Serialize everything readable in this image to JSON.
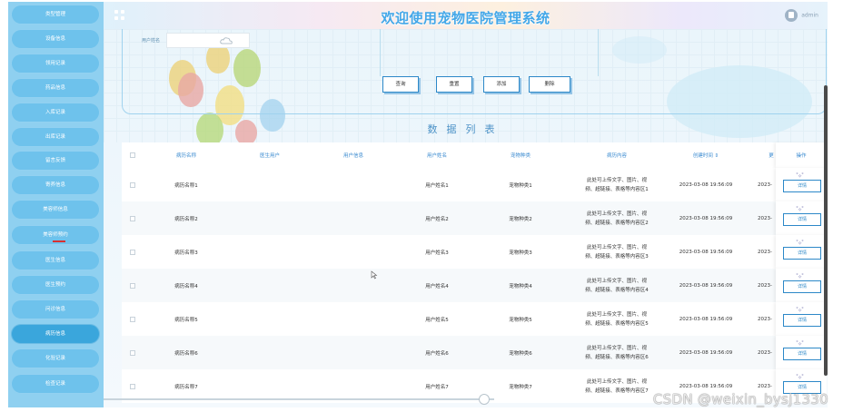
{
  "header": {
    "title": "欢迎使用宠物医院管理系统",
    "user_name": "admin"
  },
  "sidebar": {
    "items": [
      {
        "label": "类型管理"
      },
      {
        "label": "设备信息"
      },
      {
        "label": "领用记录"
      },
      {
        "label": "药品信息"
      },
      {
        "label": "入库记录"
      },
      {
        "label": "出库记录"
      },
      {
        "label": "留言反馈"
      },
      {
        "label": "寄养信息"
      },
      {
        "label": "美容师信息"
      },
      {
        "label": "美容师预约"
      },
      {
        "label": "医生信息"
      },
      {
        "label": "医生预约"
      },
      {
        "label": "问诊信息"
      },
      {
        "label": "病历信息"
      },
      {
        "label": "化验记录"
      },
      {
        "label": "检查记录"
      }
    ]
  },
  "search": {
    "field_label": "用户姓名"
  },
  "buttons": {
    "query": "查询",
    "reset": "重置",
    "add": "添加",
    "delete": "删除"
  },
  "list_title": "数据列表",
  "table": {
    "columns": [
      "病历名称",
      "医生用户",
      "用户信息",
      "用户姓名",
      "宠物种类",
      "病历内容",
      "创建时间 ⇕",
      "更",
      "操作"
    ],
    "detail_label": "详情",
    "rows": [
      {
        "name": "病历名称1",
        "user_name": "用户姓名1",
        "pet": "宠物种类1",
        "content_a": "此处可上传文字、图片、视",
        "content_b": "频、超链接、表格等内容区1",
        "time": "2023-03-08 19:56:09",
        "time2": "2023-"
      },
      {
        "name": "病历名称2",
        "user_name": "用户姓名2",
        "pet": "宠物种类2",
        "content_a": "此处可上传文字、图片、视",
        "content_b": "频、超链接、表格等内容区2",
        "time": "2023-03-08 19:56:09",
        "time2": "2023-"
      },
      {
        "name": "病历名称3",
        "user_name": "用户姓名3",
        "pet": "宠物种类3",
        "content_a": "此处可上传文字、图片、视",
        "content_b": "频、超链接、表格等内容区3",
        "time": "2023-03-08 19:56:09",
        "time2": "2023-"
      },
      {
        "name": "病历名称4",
        "user_name": "用户姓名4",
        "pet": "宠物种类4",
        "content_a": "此处可上传文字、图片、视",
        "content_b": "频、超链接、表格等内容区4",
        "time": "2023-03-08 19:56:09",
        "time2": "2023-"
      },
      {
        "name": "病历名称5",
        "user_name": "用户姓名5",
        "pet": "宠物种类5",
        "content_a": "此处可上传文字、图片、视",
        "content_b": "频、超链接、表格等内容区5",
        "time": "2023-03-08 19:56:09",
        "time2": "2023-"
      },
      {
        "name": "病历名称6",
        "user_name": "用户姓名6",
        "pet": "宠物种类6",
        "content_a": "此处可上传文字、图片、视",
        "content_b": "频、超链接、表格等内容区6",
        "time": "2023-03-08 19:56:09",
        "time2": "2023-"
      },
      {
        "name": "病历名称7",
        "user_name": "用户姓名7",
        "pet": "宠物种类7",
        "content_a": "此处可上传文字、图片、视",
        "content_b": "频、超链接、表格等内容区7",
        "time": "2023-03-08 19:56:09",
        "time2": "2023-"
      }
    ]
  },
  "watermark": "CSDN @weixin_bysj1330",
  "colors": {
    "sidebar_bg": "#8fd0f0",
    "sidebar_item": "#6ec2ec",
    "accent": "#43a7e8",
    "button_border": "#2c88c8"
  }
}
